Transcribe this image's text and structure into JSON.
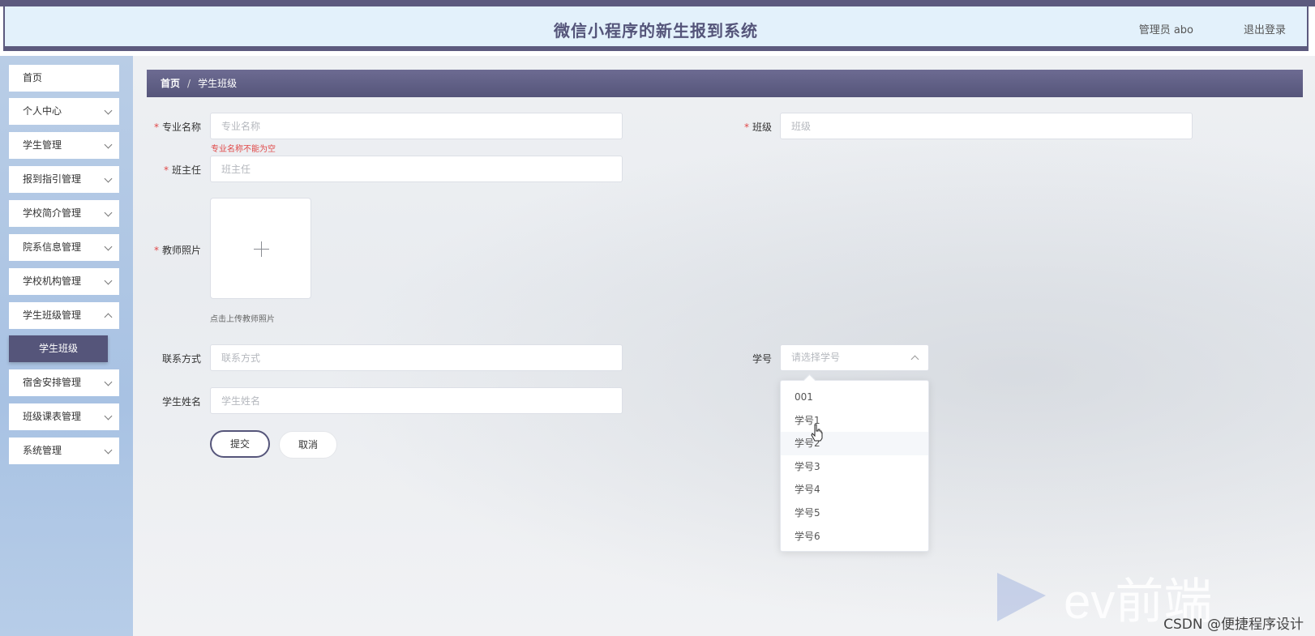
{
  "header": {
    "title": "微信小程序的新生报到系统",
    "user": "管理员 abo",
    "logout": "退出登录"
  },
  "sidebar": {
    "items": [
      {
        "label": "首页"
      },
      {
        "label": "个人中心"
      },
      {
        "label": "学生管理"
      },
      {
        "label": "报到指引管理"
      },
      {
        "label": "学校简介管理"
      },
      {
        "label": "院系信息管理"
      },
      {
        "label": "学校机构管理"
      },
      {
        "label": "学生班级管理"
      },
      {
        "label": "宿舍安排管理"
      },
      {
        "label": "班级课表管理"
      },
      {
        "label": "系统管理"
      }
    ],
    "active_sub": "学生班级"
  },
  "breadcrumb": {
    "home": "首页",
    "separator": "/",
    "current": "学生班级"
  },
  "form": {
    "major": {
      "label": "专业名称",
      "placeholder": "专业名称",
      "error": "专业名称不能为空"
    },
    "class": {
      "label": "班级",
      "placeholder": "班级"
    },
    "teacher": {
      "label": "班主任",
      "placeholder": "班主任"
    },
    "photo": {
      "label": "教师照片",
      "tip": "点击上传教师照片"
    },
    "contact": {
      "label": "联系方式",
      "placeholder": "联系方式"
    },
    "student_name": {
      "label": "学生姓名",
      "placeholder": "学生姓名"
    },
    "student_no": {
      "label": "学号",
      "placeholder": "请选择学号",
      "options": [
        "001",
        "学号1",
        "学号2",
        "学号3",
        "学号4",
        "学号5",
        "学号6"
      ]
    },
    "submit": "提交",
    "cancel": "取消"
  },
  "watermark": {
    "brand": "ev前端",
    "credit": "CSDN @便捷程序设计"
  }
}
